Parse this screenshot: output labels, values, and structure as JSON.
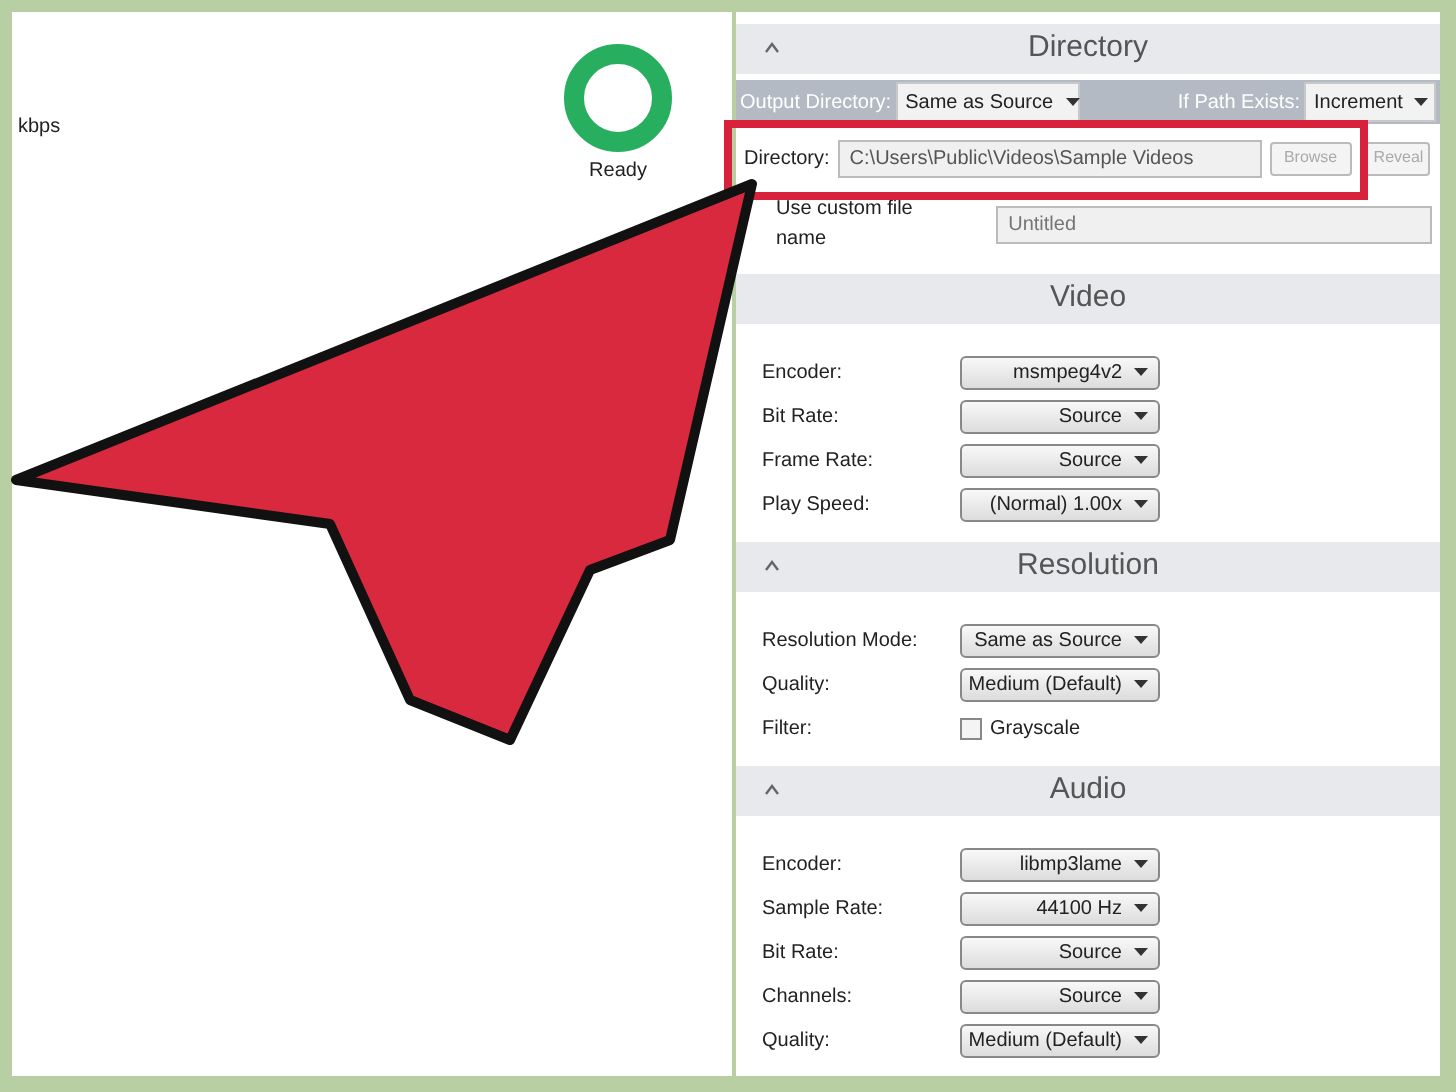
{
  "left_panel": {
    "unit_label": "kbps",
    "status": {
      "label": "Ready",
      "color": "#27ae5f"
    }
  },
  "directory": {
    "title": "Directory",
    "expanded": true,
    "output_directory": {
      "label": "Output Directory:",
      "value": "Same as Source"
    },
    "if_path_exists": {
      "label": "If Path Exists:",
      "value": "Increment"
    },
    "path": {
      "label": "Directory:",
      "value": "C:\\Users\\Public\\Videos\\Sample Videos",
      "highlighted": true
    },
    "buttons": [
      {
        "label": "Browse",
        "disabled": true
      },
      {
        "label": "Reveal",
        "disabled": true
      }
    ],
    "custom_name": {
      "label": "Use custom file name",
      "placeholder": "Untitled"
    }
  },
  "sections": [
    {
      "title": "Video",
      "rows": [
        {
          "kind": "select",
          "label": "Encoder:",
          "value": "msmpeg4v2"
        },
        {
          "kind": "select",
          "label": "Bit Rate:",
          "value": "Source"
        },
        {
          "kind": "select",
          "label": "Frame Rate:",
          "value": "Source"
        },
        {
          "kind": "select",
          "label": "Play Speed:",
          "value": "(Normal) 1.00x"
        }
      ]
    },
    {
      "title": "Resolution",
      "expanded": true,
      "rows": [
        {
          "kind": "select",
          "label": "Resolution Mode:",
          "value": "Same as Source"
        },
        {
          "kind": "select",
          "label": "Quality:",
          "value": "Medium (Default)"
        },
        {
          "kind": "checkbox",
          "label": "Filter:",
          "value": "Grayscale",
          "checked": false
        }
      ]
    },
    {
      "title": "Audio",
      "expanded": true,
      "rows": [
        {
          "kind": "select",
          "label": "Encoder:",
          "value": "libmp3lame"
        },
        {
          "kind": "select",
          "label": "Sample Rate:",
          "value": "44100 Hz"
        },
        {
          "kind": "select",
          "label": "Bit Rate:",
          "value": "Source"
        },
        {
          "kind": "select",
          "label": "Channels:",
          "value": "Source"
        },
        {
          "kind": "select",
          "label": "Quality:",
          "value": "Medium (Default)"
        }
      ]
    }
  ]
}
